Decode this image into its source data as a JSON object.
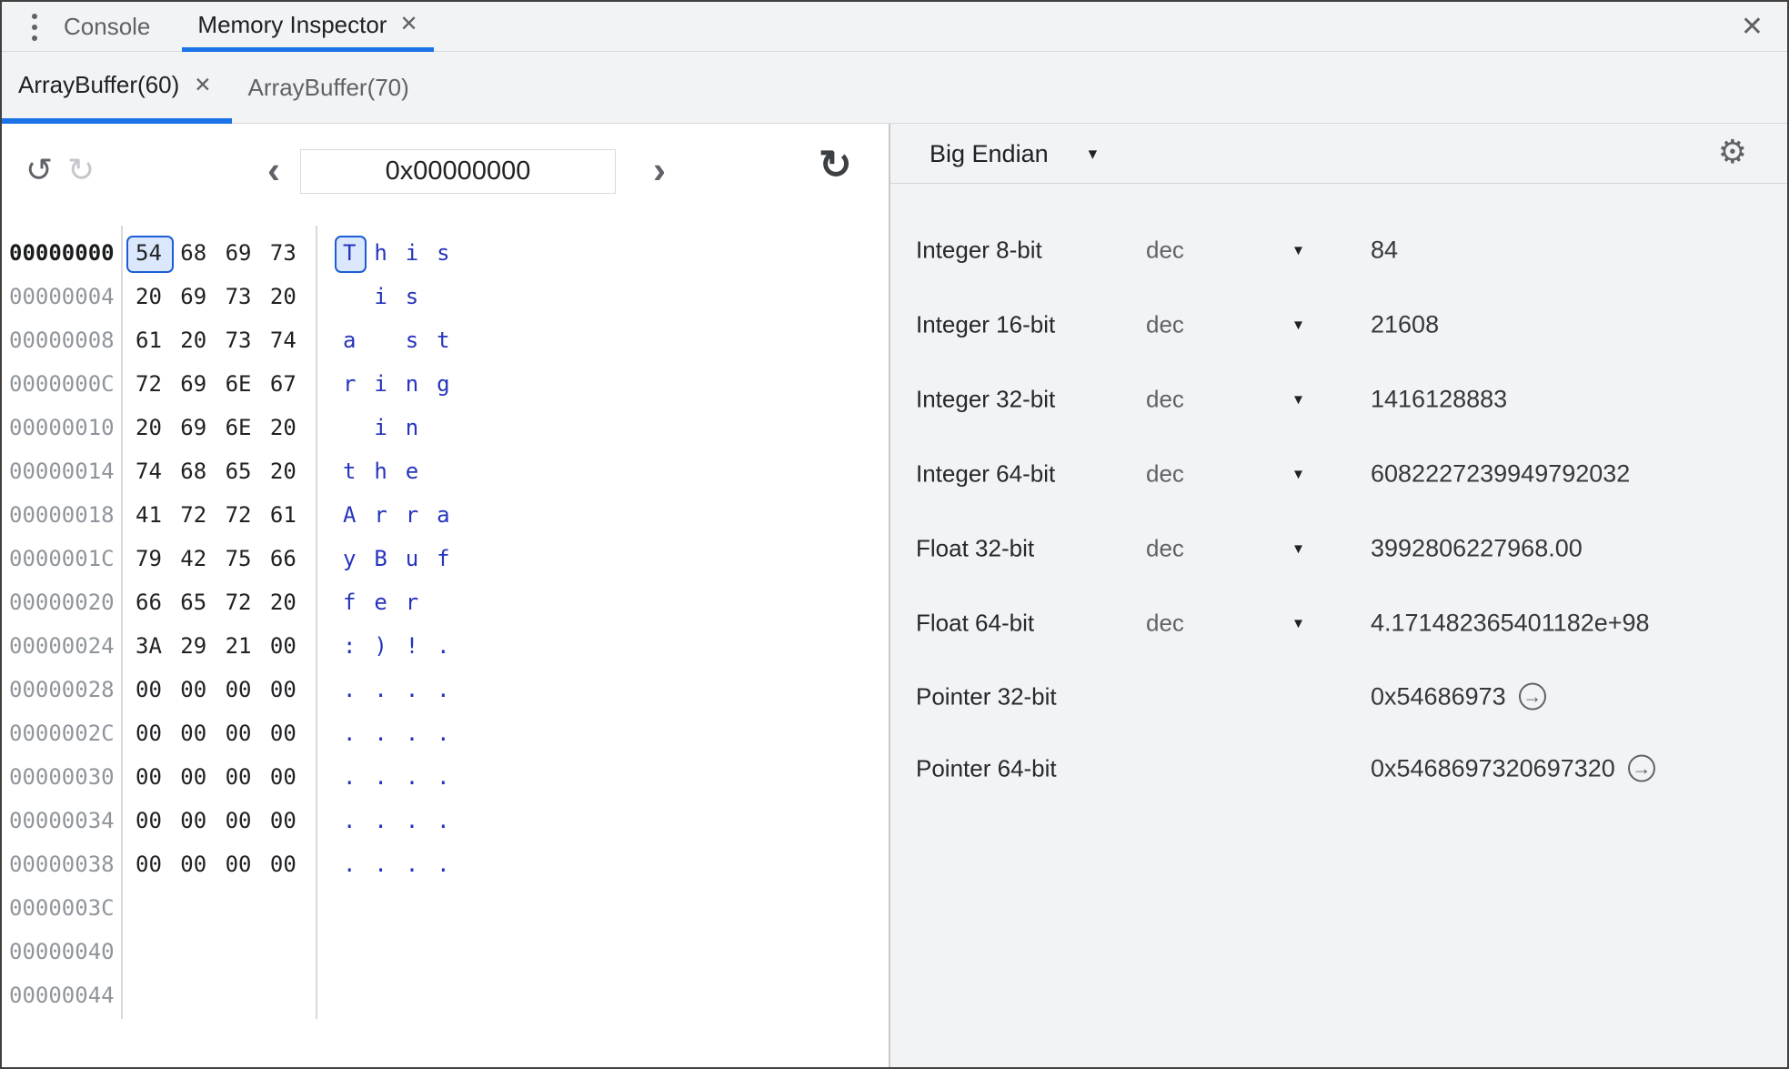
{
  "icons": {
    "kebab": "⋮",
    "close": "✕",
    "tab_close": "✕",
    "undo": "↺",
    "redo": "↻",
    "back": "‹",
    "forward": "›",
    "refresh": "↻",
    "caret": "▾",
    "gear": "⚙",
    "jump": "→"
  },
  "top_tabs": {
    "console": "Console",
    "memory_inspector": "Memory Inspector"
  },
  "buffer_tabs": [
    {
      "label": "ArrayBuffer(60)",
      "active": true,
      "closable": true
    },
    {
      "label": "ArrayBuffer(70)",
      "active": false,
      "closable": false
    }
  ],
  "toolbar": {
    "address_value": "0x00000000"
  },
  "inspector": {
    "endianness": "Big Endian",
    "selected": {
      "row": 0,
      "col": 0
    },
    "colors": {
      "accent": "#1a73e8",
      "ascii_text": "#2634bb",
      "selection_border": "#1a5ed6",
      "selection_bg": "#dbe7fd"
    },
    "hex_rows": [
      {
        "address": "00000000",
        "emphasized": true,
        "bytes": [
          "54",
          "68",
          "69",
          "73"
        ],
        "ascii": [
          "T",
          "h",
          "i",
          "s"
        ]
      },
      {
        "address": "00000004",
        "bytes": [
          "20",
          "69",
          "73",
          "20"
        ],
        "ascii": [
          "",
          "i",
          "s",
          ""
        ]
      },
      {
        "address": "00000008",
        "bytes": [
          "61",
          "20",
          "73",
          "74"
        ],
        "ascii": [
          "a",
          "",
          "s",
          "t"
        ]
      },
      {
        "address": "0000000C",
        "bytes": [
          "72",
          "69",
          "6E",
          "67"
        ],
        "ascii": [
          "r",
          "i",
          "n",
          "g"
        ]
      },
      {
        "address": "00000010",
        "bytes": [
          "20",
          "69",
          "6E",
          "20"
        ],
        "ascii": [
          "",
          "i",
          "n",
          ""
        ]
      },
      {
        "address": "00000014",
        "bytes": [
          "74",
          "68",
          "65",
          "20"
        ],
        "ascii": [
          "t",
          "h",
          "e",
          ""
        ]
      },
      {
        "address": "00000018",
        "bytes": [
          "41",
          "72",
          "72",
          "61"
        ],
        "ascii": [
          "A",
          "r",
          "r",
          "a"
        ]
      },
      {
        "address": "0000001C",
        "bytes": [
          "79",
          "42",
          "75",
          "66"
        ],
        "ascii": [
          "y",
          "B",
          "u",
          "f"
        ]
      },
      {
        "address": "00000020",
        "bytes": [
          "66",
          "65",
          "72",
          "20"
        ],
        "ascii": [
          "f",
          "e",
          "r",
          ""
        ]
      },
      {
        "address": "00000024",
        "bytes": [
          "3A",
          "29",
          "21",
          "00"
        ],
        "ascii": [
          ":",
          ")",
          "!",
          "."
        ]
      },
      {
        "address": "00000028",
        "bytes": [
          "00",
          "00",
          "00",
          "00"
        ],
        "ascii": [
          ".",
          ".",
          ".",
          "."
        ]
      },
      {
        "address": "0000002C",
        "bytes": [
          "00",
          "00",
          "00",
          "00"
        ],
        "ascii": [
          ".",
          ".",
          ".",
          "."
        ]
      },
      {
        "address": "00000030",
        "bytes": [
          "00",
          "00",
          "00",
          "00"
        ],
        "ascii": [
          ".",
          ".",
          ".",
          "."
        ]
      },
      {
        "address": "00000034",
        "bytes": [
          "00",
          "00",
          "00",
          "00"
        ],
        "ascii": [
          ".",
          ".",
          ".",
          "."
        ]
      },
      {
        "address": "00000038",
        "bytes": [
          "00",
          "00",
          "00",
          "00"
        ],
        "ascii": [
          ".",
          ".",
          ".",
          "."
        ]
      },
      {
        "address": "0000003C",
        "bytes": [],
        "ascii": []
      },
      {
        "address": "00000040",
        "bytes": [],
        "ascii": []
      },
      {
        "address": "00000044",
        "bytes": [],
        "ascii": []
      }
    ],
    "value_rows": [
      {
        "label": "Integer 8-bit",
        "format": "dec",
        "value": "84"
      },
      {
        "label": "Integer 16-bit",
        "format": "dec",
        "value": "21608"
      },
      {
        "label": "Integer 32-bit",
        "format": "dec",
        "value": "1416128883"
      },
      {
        "label": "Integer 64-bit",
        "format": "dec",
        "value": "6082227239949792032"
      },
      {
        "label": "Float 32-bit",
        "format": "dec",
        "value": "3992806227968.00"
      },
      {
        "label": "Float 64-bit",
        "format": "dec",
        "value": "4.171482365401182e+98"
      },
      {
        "label": "Pointer 32-bit",
        "format": null,
        "value": "0x54686973",
        "jump": true
      },
      {
        "label": "Pointer 64-bit",
        "format": null,
        "value": "0x5468697320697320",
        "jump": true
      }
    ]
  }
}
